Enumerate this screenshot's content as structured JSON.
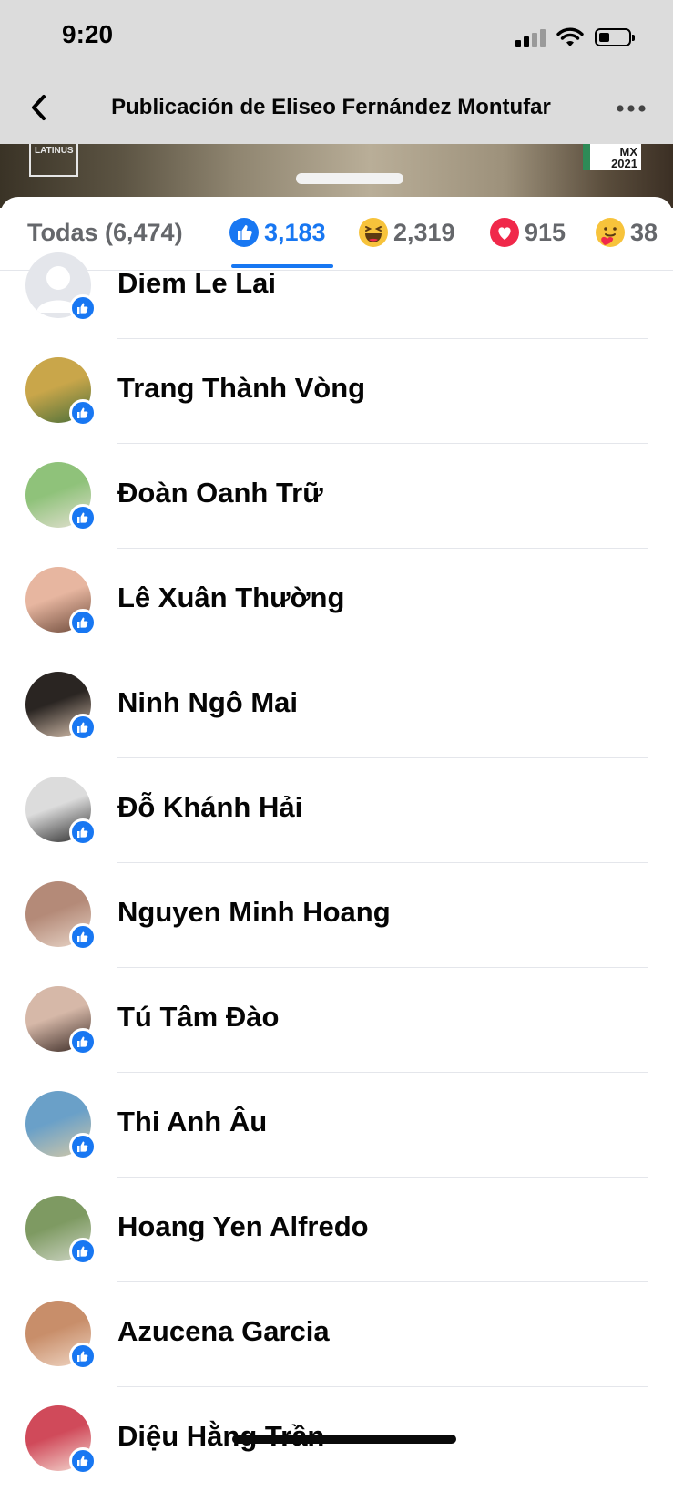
{
  "status_bar": {
    "time": "9:20",
    "icons": [
      "cellular-signal-icon",
      "wifi-icon",
      "battery-icon"
    ],
    "battery_level": 0.35
  },
  "nav": {
    "title": "Publicación de Eliseo Fernández Montufar",
    "back_icon": "chevron-left-icon",
    "more_icon": "more-horizontal-icon"
  },
  "post_image": {
    "logo_left": "LATINUS",
    "logo_right": "MX\n2021"
  },
  "tabs": [
    {
      "label": "Todas (6,474)",
      "icon": null,
      "active": false
    },
    {
      "label": "3,183",
      "icon": "like-icon",
      "active": true,
      "color": "#1877f2"
    },
    {
      "label": "2,319",
      "icon": "haha-icon",
      "active": false
    },
    {
      "label": "915",
      "icon": "love-icon",
      "active": false
    },
    {
      "label": "38",
      "icon": "care-icon",
      "active": false
    }
  ],
  "reactors": [
    {
      "name": "Diem Le Lai",
      "reaction": "like-icon",
      "avatar": "default-avatar"
    },
    {
      "name": "Trang Thành Vòng",
      "reaction": "like-icon",
      "avatar": "photo"
    },
    {
      "name": "Đoàn Oanh Trữ",
      "reaction": "like-icon",
      "avatar": "photo"
    },
    {
      "name": "Lê Xuân Thường",
      "reaction": "like-icon",
      "avatar": "photo"
    },
    {
      "name": "Ninh Ngô Mai",
      "reaction": "like-icon",
      "avatar": "photo"
    },
    {
      "name": "Đỗ Khánh Hải",
      "reaction": "like-icon",
      "avatar": "photo"
    },
    {
      "name": "Nguyen Minh Hoang",
      "reaction": "like-icon",
      "avatar": "photo"
    },
    {
      "name": "Tú Tâm Đào",
      "reaction": "like-icon",
      "avatar": "photo"
    },
    {
      "name": "Thi Anh Âu",
      "reaction": "like-icon",
      "avatar": "photo"
    },
    {
      "name": "Hoang Yen Alfredo",
      "reaction": "like-icon",
      "avatar": "photo"
    },
    {
      "name": "Azucena Garcia",
      "reaction": "like-icon",
      "avatar": "photo"
    },
    {
      "name": "Diệu Hằng Trần",
      "reaction": "like-icon",
      "avatar": "photo"
    }
  ],
  "colors": {
    "accent": "#1877f2",
    "text": "#050505",
    "secondary_text": "#65676b",
    "divider": "#e4e6eb",
    "header_bg": "#dcdcdc"
  }
}
